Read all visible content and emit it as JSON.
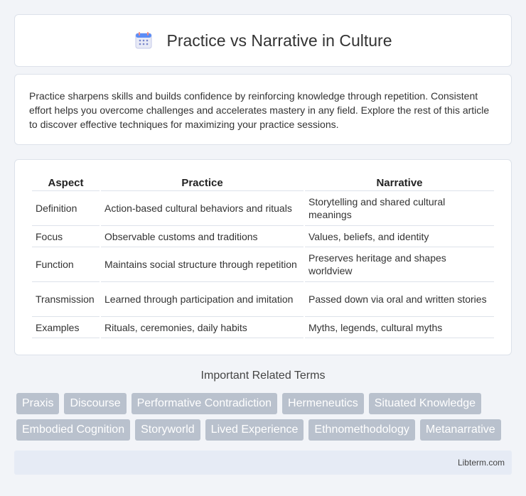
{
  "header": {
    "title": "Practice vs Narrative in Culture",
    "icon": "calendar-icon"
  },
  "intro": {
    "text": "Practice sharpens skills and builds confidence by reinforcing knowledge through repetition. Consistent effort helps you overcome challenges and accelerates mastery in any field. Explore the rest of this article to discover effective techniques for maximizing your practice sessions."
  },
  "table": {
    "headers": [
      "Aspect",
      "Practice",
      "Narrative"
    ],
    "rows": [
      [
        "Definition",
        "Action-based cultural behaviors and rituals",
        "Storytelling and shared cultural meanings"
      ],
      [
        "Focus",
        "Observable customs and traditions",
        "Values, beliefs, and identity"
      ],
      [
        "Function",
        "Maintains social structure through repetition",
        "Preserves heritage and shapes worldview"
      ],
      [
        "Transmission",
        "Learned through participation and imitation",
        "Passed down via oral and written stories"
      ],
      [
        "Examples",
        "Rituals, ceremonies, daily habits",
        "Myths, legends, cultural myths"
      ]
    ]
  },
  "related": {
    "title": "Important Related Terms",
    "row1": [
      "Praxis",
      "Discourse",
      "Performative Contradiction",
      "Hermeneutics",
      "Situated Knowledge"
    ],
    "row2": [
      "Embodied Cognition",
      "Storyworld",
      "Lived Experience",
      "Ethnomethodology",
      "Metanarrative"
    ]
  },
  "footer": {
    "text": "Libterm.com"
  }
}
